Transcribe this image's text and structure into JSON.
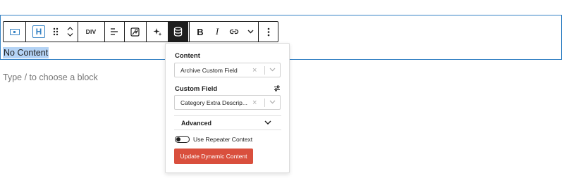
{
  "block": {
    "text": "No Content",
    "appender_placeholder": "Type / to choose a block"
  },
  "toolbar": {
    "heading_letter": "H",
    "tag_label": "DIV",
    "bold_label": "B",
    "italic_label": "I",
    "icons": [
      "parent-block-icon",
      "heading-icon",
      "drag-handle-icon",
      "chevron-up-icon",
      "chevron-down-icon",
      "align-icon",
      "image-icon",
      "sparkle-icon",
      "database-icon",
      "link-icon",
      "chevron-down-icon",
      "more-vertical-icon"
    ]
  },
  "popover": {
    "content_label": "Content",
    "content_value": "Archive Custom Field",
    "custom_field_label": "Custom Field",
    "custom_field_value": "Category Extra Descrip...",
    "advanced_label": "Advanced",
    "toggle_label": "Use Repeater Context",
    "toggle_on": false,
    "button_label": "Update Dynamic Content"
  },
  "colors": {
    "accent": "#3582c4",
    "selection": "#b4d3f5",
    "button": "#d94f3d",
    "text": "#1e1e1e",
    "muted": "#757575"
  }
}
